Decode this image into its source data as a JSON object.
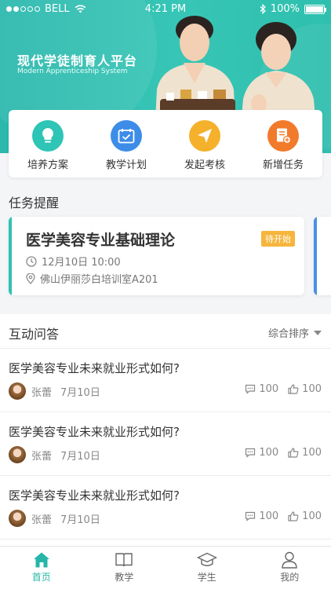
{
  "status_bar": {
    "carrier": "BELL",
    "time": "4:21 PM",
    "battery": "100%"
  },
  "hero": {
    "title": "现代学徒制育人平台",
    "subtitle": "Modern Apprenticeship System"
  },
  "quick_actions": [
    {
      "label": "培养方案",
      "icon": "lightbulb-icon",
      "color": "#2ec4b6"
    },
    {
      "label": "教学计划",
      "icon": "calendar-icon",
      "color": "#3d8de8"
    },
    {
      "label": "发起考核",
      "icon": "paper-plane-icon",
      "color": "#f5b12c"
    },
    {
      "label": "新增任务",
      "icon": "task-add-icon",
      "color": "#f27a2b"
    }
  ],
  "tasks": {
    "section_title": "任务提醒",
    "items": [
      {
        "title": "医学美容专业基础理论",
        "status": "待开始",
        "time": "12月10日 10:00",
        "location": "佛山伊丽莎白培训室A201"
      }
    ]
  },
  "qa": {
    "section_title": "互动问答",
    "sort_label": "综合排序",
    "items": [
      {
        "question": "医学美容专业未来就业形式如何?",
        "author": "张蕾",
        "date": "7月10日",
        "comments": "100",
        "likes": "100"
      },
      {
        "question": "医学美容专业未来就业形式如何?",
        "author": "张蕾",
        "date": "7月10日",
        "comments": "100",
        "likes": "100"
      },
      {
        "question": "医学美容专业未来就业形式如何?",
        "author": "张蕾",
        "date": "7月10日",
        "comments": "100",
        "likes": "100"
      }
    ]
  },
  "tab_bar": [
    {
      "label": "首页",
      "icon": "home-icon",
      "active": true
    },
    {
      "label": "教学",
      "icon": "book-icon",
      "active": false
    },
    {
      "label": "学生",
      "icon": "graduation-cap-icon",
      "active": false
    },
    {
      "label": "我的",
      "icon": "user-icon",
      "active": false
    }
  ]
}
